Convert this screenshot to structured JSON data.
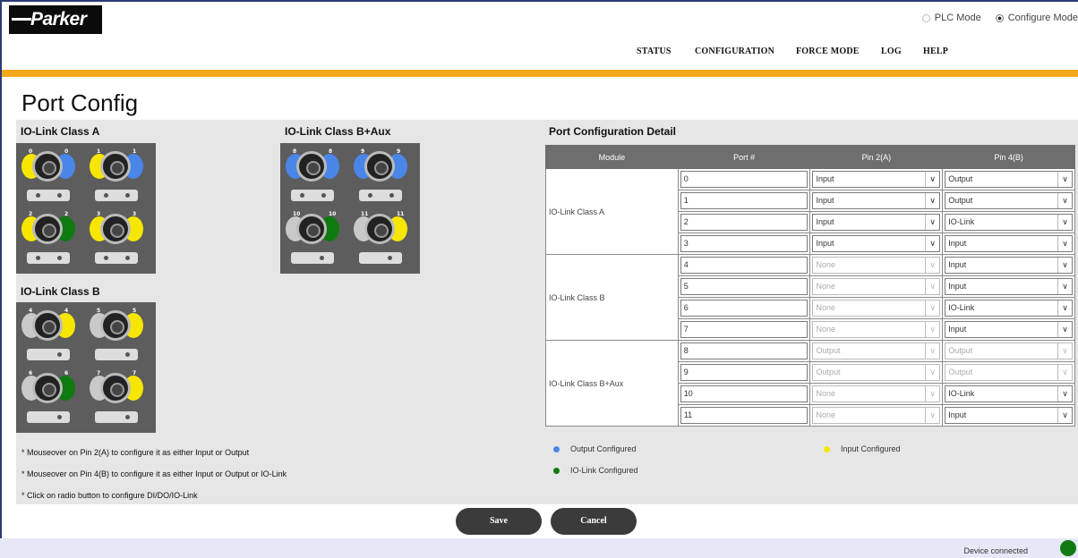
{
  "header": {
    "logo_text": "Parker",
    "modes": [
      {
        "label": "PLC Mode",
        "selected": false
      },
      {
        "label": "Configure Mode",
        "selected": true
      }
    ],
    "nav": [
      "STATUS",
      "CONFIGURATION",
      "FORCE MODE",
      "LOG",
      "HELP"
    ]
  },
  "page_title": "Port Config",
  "sections": {
    "class_a": "IO-Link Class A",
    "class_b_aux": "IO-Link Class B+Aux",
    "class_b": "IO-Link Class B",
    "detail": "Port Configuration Detail"
  },
  "table": {
    "headers": [
      "Module",
      "Port #",
      "Pin 2(A)",
      "Pin 4(B)"
    ],
    "groups": [
      {
        "module": "IO-Link Class A",
        "rows": [
          {
            "port": "0",
            "pin2": "Input",
            "pin2_enabled": true,
            "pin4": "Output",
            "pin4_enabled": true
          },
          {
            "port": "1",
            "pin2": "Input",
            "pin2_enabled": true,
            "pin4": "Output",
            "pin4_enabled": true
          },
          {
            "port": "2",
            "pin2": "Input",
            "pin2_enabled": true,
            "pin4": "IO-Link",
            "pin4_enabled": true
          },
          {
            "port": "3",
            "pin2": "Input",
            "pin2_enabled": true,
            "pin4": "Input",
            "pin4_enabled": true
          }
        ]
      },
      {
        "module": "IO-Link Class B",
        "rows": [
          {
            "port": "4",
            "pin2": "None",
            "pin2_enabled": false,
            "pin4": "Input",
            "pin4_enabled": true
          },
          {
            "port": "5",
            "pin2": "None",
            "pin2_enabled": false,
            "pin4": "Input",
            "pin4_enabled": true
          },
          {
            "port": "6",
            "pin2": "None",
            "pin2_enabled": false,
            "pin4": "IO-Link",
            "pin4_enabled": true
          },
          {
            "port": "7",
            "pin2": "None",
            "pin2_enabled": false,
            "pin4": "Input",
            "pin4_enabled": true
          }
        ]
      },
      {
        "module": "IO-Link Class B+Aux",
        "rows": [
          {
            "port": "8",
            "pin2": "Output",
            "pin2_enabled": false,
            "pin4": "Output",
            "pin4_enabled": false
          },
          {
            "port": "9",
            "pin2": "Output",
            "pin2_enabled": false,
            "pin4": "Output",
            "pin4_enabled": false
          },
          {
            "port": "10",
            "pin2": "None",
            "pin2_enabled": false,
            "pin4": "IO-Link",
            "pin4_enabled": true
          },
          {
            "port": "11",
            "pin2": "None",
            "pin2_enabled": false,
            "pin4": "Input",
            "pin4_enabled": true
          }
        ]
      }
    ]
  },
  "notes": [
    "* Mouseover on Pin 2(A) to configure it as either Input or Output",
    "* Mouseover on Pin 4(B) to configure it as either Input or Output or IO-Link",
    "* Click on radio button to configure DI/DO/IO-Link"
  ],
  "legend": {
    "output": {
      "label": "Output Configured",
      "color": "#4a86e8"
    },
    "input": {
      "label": "Input Configured",
      "color": "#f7e600"
    },
    "iolink": {
      "label": "IO-Link Configured",
      "color": "#0f7a0f"
    }
  },
  "buttons": {
    "save": "Save",
    "cancel": "Cancel"
  },
  "status": {
    "text": "Device connected",
    "color": "#117a11"
  },
  "module_ports": {
    "class_a": [
      {
        "num": "0",
        "left": "#f7e600",
        "right": "#4a86e8"
      },
      {
        "num": "1",
        "left": "#f7e600",
        "right": "#4a86e8"
      },
      {
        "num": "2",
        "left": "#f7e600",
        "right": "#0f7a0f"
      },
      {
        "num": "3",
        "left": "#f7e600",
        "right": "#f7e600"
      }
    ],
    "class_b_aux": [
      {
        "num": "8",
        "left": "#4a86e8",
        "right": "#4a86e8"
      },
      {
        "num": "9",
        "left": "#4a86e8",
        "right": "#4a86e8"
      },
      {
        "num": "10",
        "left": "#c9c9c9",
        "right": "#0f7a0f"
      },
      {
        "num": "11",
        "left": "#c9c9c9",
        "right": "#f7e600"
      }
    ],
    "class_b": [
      {
        "num": "4",
        "left": "#c9c9c9",
        "right": "#f7e600"
      },
      {
        "num": "5",
        "left": "#c9c9c9",
        "right": "#f7e600"
      },
      {
        "num": "6",
        "left": "#c9c9c9",
        "right": "#0f7a0f"
      },
      {
        "num": "7",
        "left": "#c9c9c9",
        "right": "#f7e600"
      }
    ]
  }
}
